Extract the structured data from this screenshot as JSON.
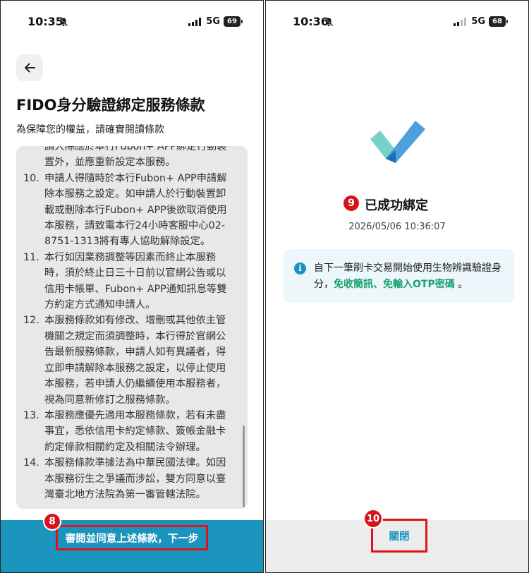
{
  "left_screen": {
    "status_bar": {
      "time": "10:35",
      "network": "5G",
      "battery": "69"
    },
    "title": "FIDO身分驗證綁定服務條款",
    "subtitle": "為保障您的權益，請確實閱讀條款",
    "terms_top_fragments": [
      "請人除應於本行Fubon+ APP綁定行動裝",
      "置外，並應重新設定本服務。"
    ],
    "terms": [
      {
        "num": "10.",
        "text": "申請人得隨時於本行Fubon+ APP申請解除本服務之設定。如申請人於行動裝置卸載或刪除本行Fubon+ APP後欲取消使用本服務，請致電本行24小時客服中心02-8751-1313將有專人協助解除設定。"
      },
      {
        "num": "11.",
        "text": "本行如因業務調整等因素而終止本服務時，須於終止日三十日前以官網公告或以信用卡帳單、Fubon+ APP通知訊息等雙方約定方式通知申請人。"
      },
      {
        "num": "12.",
        "text": "本服務條款如有修改、增刪或其他依主管機關之規定而須調整時，本行得於官網公告最新服務條款，申請人如有異議者，得立即申請解除本服務之設定，以停止使用本服務，若申請人仍繼續使用本服務者，視為同意新修訂之服務條款。"
      },
      {
        "num": "13.",
        "text": "本服務應優先適用本服務條款，若有未盡事宜，悉依信用卡約定條款、簽帳金融卡約定條款相關約定及相關法令辦理。"
      },
      {
        "num": "14.",
        "text": "本服務條款準據法為中華民國法律。如因本服務衍生之爭議而涉訟，雙方同意以臺灣臺北地方法院為第一審管轄法院。"
      }
    ],
    "agree_button": "審閱並同意上述條款，下一步",
    "step_marker": "8"
  },
  "right_screen": {
    "status_bar": {
      "time": "10:36",
      "network": "5G",
      "battery": "68"
    },
    "success_title": "已成功綁定",
    "success_time": "2026/05/06 10:36:07",
    "info_prefix": "自下一筆刷卡交易開始使用生物辨識驗證身分，",
    "info_highlight": "免收簡訊、免輸入OTP密碼",
    "info_suffix": "。",
    "close_button": "關閉",
    "step_marker_success": "9",
    "step_marker_close": "10"
  },
  "icons": {
    "back": "arrow-left-icon",
    "mute": "bell-off-icon",
    "signal": "signal-icon",
    "battery": "battery-icon",
    "check": "checkmark-icon",
    "info": "info-icon"
  },
  "colors": {
    "primary": "#1a93bd",
    "highlight": "#17a06f",
    "marker": "#d6131b",
    "annotation_border": "#e0141b"
  }
}
